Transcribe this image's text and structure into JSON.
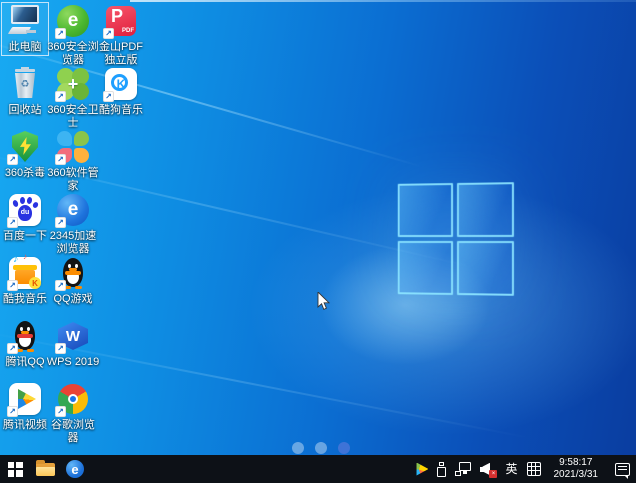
{
  "desktop": {
    "icons": [
      {
        "id": "this-pc",
        "label": "此电脑"
      },
      {
        "id": "360-browser",
        "label": "360安全浏览器",
        "glyph": "e"
      },
      {
        "id": "kingsoft-pdf",
        "label": "金山PDF独立版",
        "glyph": "P",
        "sub": "PDF"
      },
      {
        "id": "recycle-bin",
        "label": "回收站"
      },
      {
        "id": "360-guard",
        "label": "360安全卫士",
        "glyph": "+"
      },
      {
        "id": "kugou-music",
        "label": "酷狗音乐",
        "glyph": "K"
      },
      {
        "id": "360-antivirus",
        "label": "360杀毒"
      },
      {
        "id": "360-manager",
        "label": "360软件管家"
      },
      {
        "id": "baidu",
        "label": "百度一下",
        "glyph": "du"
      },
      {
        "id": "2345-browser",
        "label": "2345加速浏览器",
        "glyph": "e"
      },
      {
        "id": "kuwo-music",
        "label": "酷我音乐",
        "glyph": "K"
      },
      {
        "id": "qq-games",
        "label": "QQ游戏"
      },
      {
        "id": "tencent-qq",
        "label": "腾讯QQ"
      },
      {
        "id": "wps-2019",
        "label": "WPS 2019",
        "glyph": "W"
      },
      {
        "id": "tencent-video",
        "label": "腾讯视频"
      },
      {
        "id": "chrome",
        "label": "谷歌浏览器"
      }
    ],
    "pager_dots": {
      "count": 3,
      "active": 3
    }
  },
  "taskbar": {
    "browser_glyph": "e",
    "ime": {
      "lang": "英"
    },
    "clock": {
      "time": "9:58:17",
      "date": "2021/3/31"
    }
  },
  "colors": {
    "wallpaper_light": "#18aaf2",
    "wallpaper_dark": "#0a3da0",
    "taskbar_bg": "#0d1117",
    "logo_edge": "#8ce4ff",
    "mute_badge": "#d32f2f"
  }
}
